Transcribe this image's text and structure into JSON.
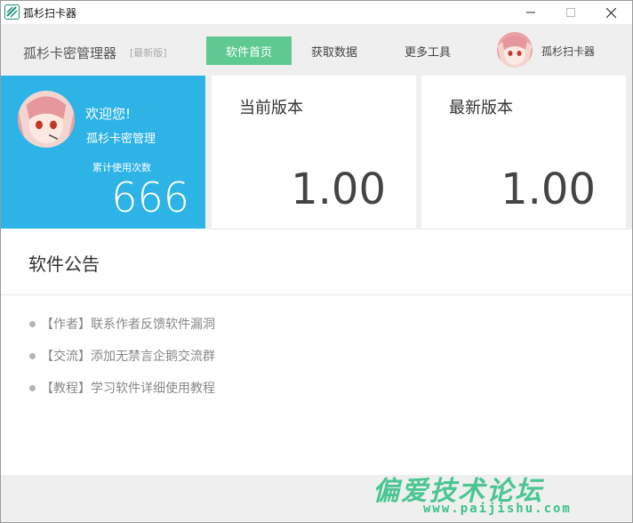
{
  "window": {
    "title": "孤杉扫卡器"
  },
  "header": {
    "brand": "孤杉卡密管理器",
    "brand_tag": "[最新版]",
    "nav": [
      {
        "label": "软件首页",
        "active": true
      },
      {
        "label": "获取数据",
        "active": false
      },
      {
        "label": "更多工具",
        "active": false
      }
    ],
    "user_name": "孤杉扫卡器"
  },
  "cards": {
    "welcome": {
      "greeting": "欢迎您!",
      "subtitle": "孤杉卡密管理",
      "usage_label": "累计使用次数",
      "usage_count": "666"
    },
    "current_version": {
      "title": "当前版本",
      "value": "1.00"
    },
    "latest_version": {
      "title": "最新版本",
      "value": "1.00"
    }
  },
  "notice": {
    "title": "软件公告",
    "items": [
      "【作者】联系作者反馈软件漏洞",
      "【交流】添加无禁言企鹅交流群",
      "【教程】学习软件详细使用教程"
    ]
  },
  "watermark": {
    "main": "偏爱技术论坛",
    "url": "www.paijishu.com"
  },
  "colors": {
    "accent_green": "#5fc993",
    "card_blue": "#2eb3e6",
    "watermark_green": "#3ac28a"
  }
}
